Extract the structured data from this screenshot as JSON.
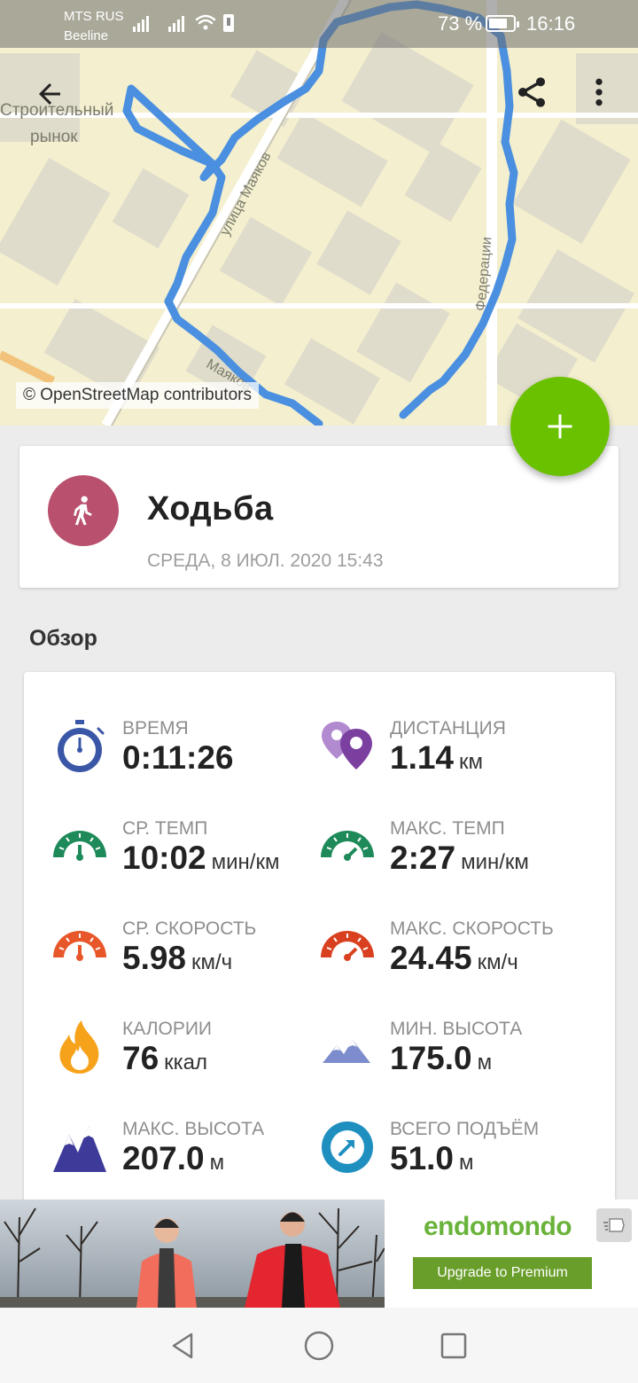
{
  "status_bar": {
    "carrier_1": "MTS RUS",
    "carrier_2": "Beeline",
    "battery": "73 %",
    "time": "16:16"
  },
  "map": {
    "labels": [
      "Строительный",
      "рынок",
      "Марк",
      "улица Маяков",
      "Федерации",
      "Маяков"
    ],
    "attribution": "© OpenStreetMap contributors",
    "route_color": "#4a8fe0"
  },
  "toolbar": {
    "back_icon": "arrow-left-icon",
    "share_icon": "share-icon",
    "more_icon": "more-vert-icon"
  },
  "fab": {
    "icon": "plus-icon",
    "color": "#6ac100"
  },
  "workout": {
    "sport_icon": "walking-icon",
    "sport_color": "#b9506d",
    "sport": "Ходьба",
    "date": "СРЕДА, 8 ИЮЛ. 2020 15:43"
  },
  "overview": {
    "title": "Обзор",
    "stats": [
      {
        "icon": "stopwatch-icon",
        "label": "ВРЕМЯ",
        "value": "0:11:26",
        "unit": ""
      },
      {
        "icon": "distance-pin-icon",
        "label": "ДИСТАНЦИЯ",
        "value": "1.14",
        "unit": "км"
      },
      {
        "icon": "avg-pace-gauge-icon",
        "label": "СР. ТЕМП",
        "value": "10:02",
        "unit": "мин/км"
      },
      {
        "icon": "max-pace-gauge-icon",
        "label": "МАКС. ТЕМП",
        "value": "2:27",
        "unit": "мин/км"
      },
      {
        "icon": "avg-speed-gauge-icon",
        "label": "СР. СКОРОСТЬ",
        "value": "5.98",
        "unit": "км/ч"
      },
      {
        "icon": "max-speed-gauge-icon",
        "label": "МАКС. СКОРОСТЬ",
        "value": "24.45",
        "unit": "км/ч"
      },
      {
        "icon": "flame-icon",
        "label": "КАЛОРИИ",
        "value": "76",
        "unit": "ккал"
      },
      {
        "icon": "min-altitude-icon",
        "label": "МИН. ВЫСОТА",
        "value": "175.0",
        "unit": "м"
      },
      {
        "icon": "max-altitude-icon",
        "label": "МАКС. ВЫСОТА",
        "value": "207.0",
        "unit": "м"
      },
      {
        "icon": "ascent-icon",
        "label": "ВСЕГО ПОДЪЁМ",
        "value": "51.0",
        "unit": "м"
      }
    ]
  },
  "ad": {
    "brand": "endomondo",
    "cta": "Upgrade to Premium"
  },
  "nav": {
    "back_icon": "nav-back-icon",
    "home_icon": "nav-home-icon",
    "recents_icon": "nav-recents-icon"
  }
}
